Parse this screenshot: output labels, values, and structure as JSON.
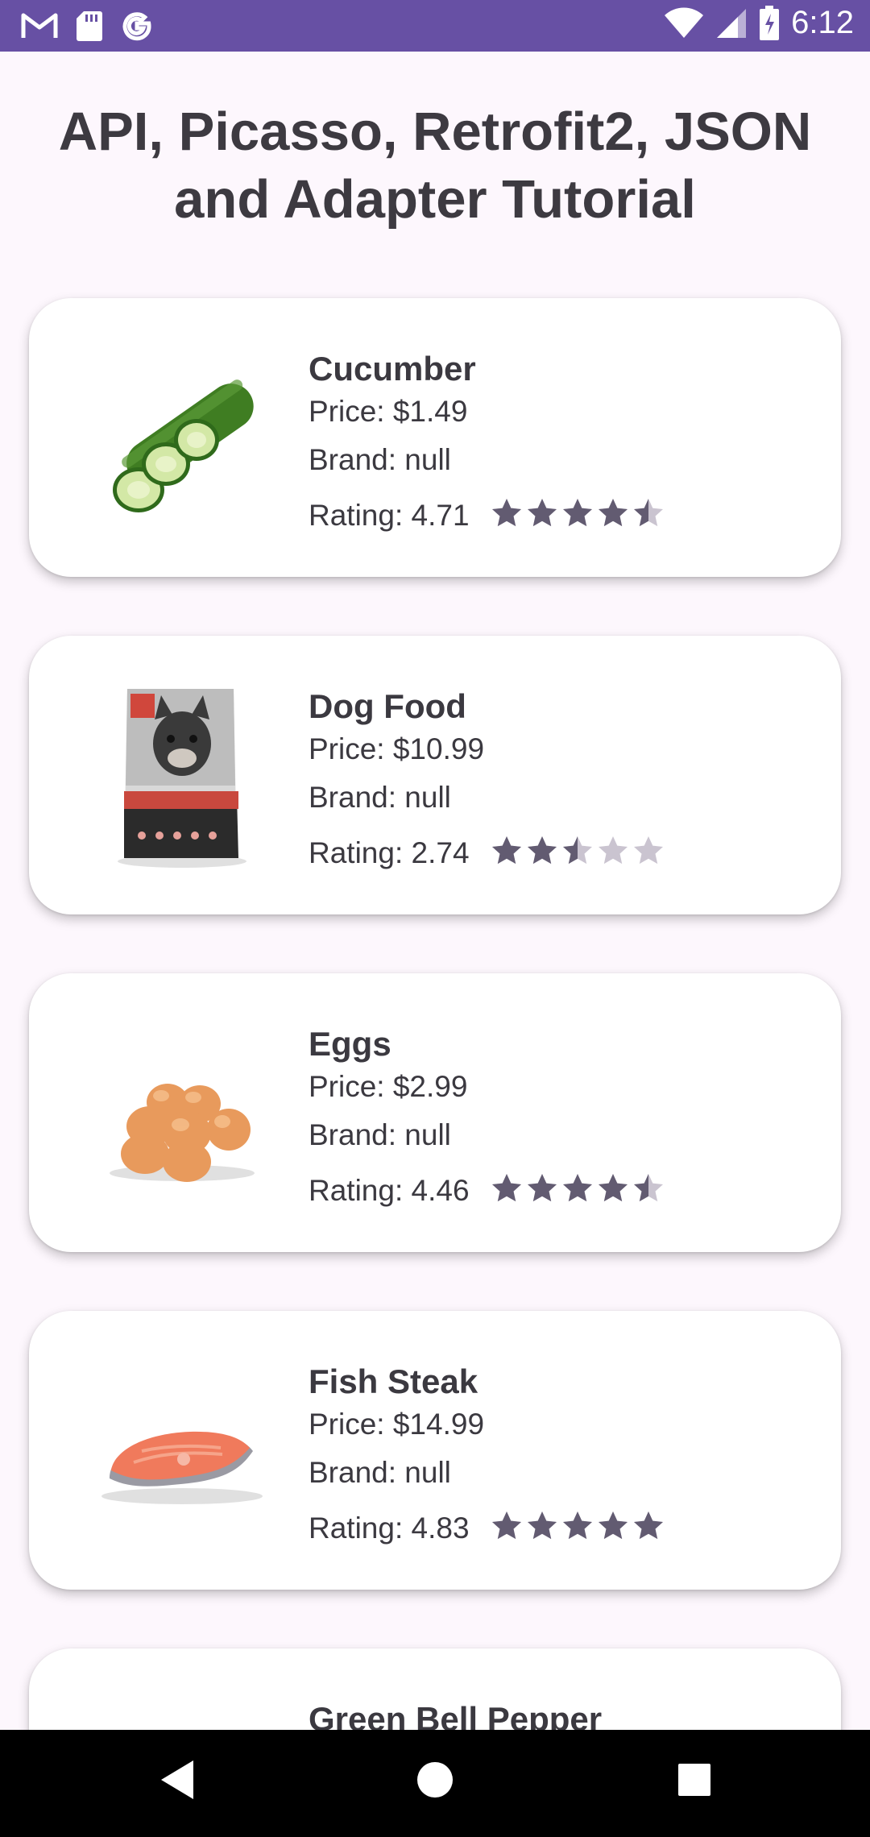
{
  "status_bar": {
    "time": "6:12",
    "left_icons": [
      "gmail-icon",
      "sd-card-icon",
      "google-icon"
    ],
    "right_icons": [
      "wifi-icon",
      "cell-signal-icon",
      "battery-icon"
    ]
  },
  "page": {
    "title_line1": "API, Picasso, Retrofit2, JSON",
    "title_line2": "and Adapter Tutorial"
  },
  "colors": {
    "accent": "#6750a4",
    "star_filled": "#625b71",
    "star_empty": "#cac4d0",
    "background": "#fdf7fd"
  },
  "products": [
    {
      "name": "Cucumber",
      "price": "Price: $1.49",
      "brand": "Brand: null",
      "rating": "Rating: 4.71",
      "rating_value": 4.5,
      "image": "cucumber-image"
    },
    {
      "name": "Dog Food",
      "price": "Price: $10.99",
      "brand": "Brand: null",
      "rating": "Rating: 2.74",
      "rating_value": 2.5,
      "image": "dog-food-image"
    },
    {
      "name": "Eggs",
      "price": "Price: $2.99",
      "brand": "Brand: null",
      "rating": "Rating: 4.46",
      "rating_value": 4.5,
      "image": "eggs-image"
    },
    {
      "name": "Fish Steak",
      "price": "Price: $14.99",
      "brand": "Brand: null",
      "rating": "Rating: 4.83",
      "rating_value": 5,
      "image": "fish-steak-image"
    },
    {
      "name": "Green Bell Pepper",
      "price": "",
      "brand": "",
      "rating": "",
      "rating_value": null,
      "image": "green-bell-pepper-image"
    }
  ],
  "nav_bar": [
    "back-icon",
    "home-icon",
    "recents-icon"
  ]
}
